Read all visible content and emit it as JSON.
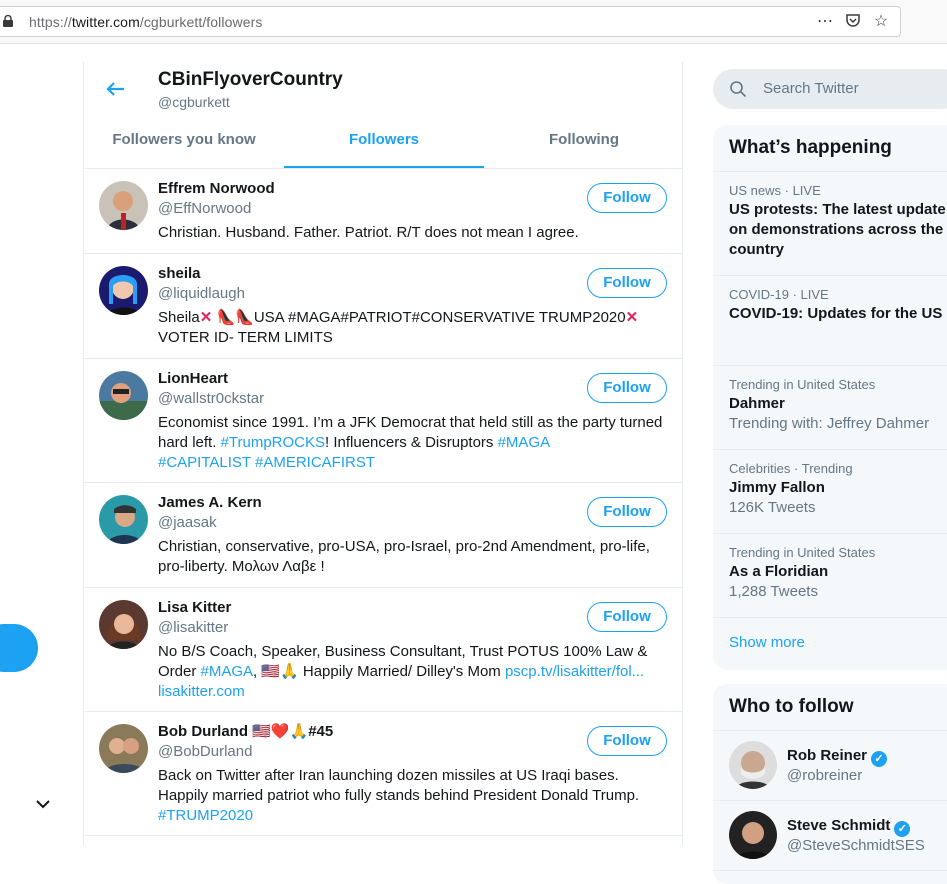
{
  "browser": {
    "url_prefix": "https://",
    "url_host": "twitter.com",
    "url_path": "/cgburkett/followers",
    "more_icon": "⋯",
    "pocket_icon": "pocket-icon",
    "star_icon": "☆"
  },
  "header": {
    "name": "CBinFlyoverCountry",
    "handle": "@cgburkett",
    "tabs": [
      "Followers you know",
      "Followers",
      "Following"
    ]
  },
  "follow_label": "Follow",
  "users": [
    {
      "name": "Effrem Norwood",
      "handle": "@EffNorwood",
      "bio": "Christian. Husband. Father. Patriot. R/T does not mean I agree."
    },
    {
      "name": "sheila",
      "handle": "@liquidlaugh",
      "bio_a": "Sheila",
      "bio_b": "USA #MAGA#PATRIOT#CONSERVATIVE TRUMP2020",
      "bio_c": "VOTER ID- TERM LIMITS"
    },
    {
      "name": "LionHeart",
      "handle": "@wallstr0ckstar",
      "bio_a": "Economist since 1991. I’m a JFK Democrat that held still as the party turned hard left. ",
      "link1": "#TrumpROCKS",
      "bio_b": "! Influencers & Disruptors ",
      "link2": "#MAGA",
      "link3": "#CAPITALIST",
      "link4": "#AMERICAFIRST"
    },
    {
      "name": "James A. Kern",
      "handle": "@jaasak",
      "bio": "Christian, conservative, pro-USA, pro-Israel, pro-2nd Amendment, pro-life, pro-liberty. Μολων Λαβε !"
    },
    {
      "name": "Lisa Kitter",
      "handle": "@lisakitter",
      "bio_a": "No B/S Coach, Speaker, Business Consultant, Trust POTUS 100% Law & Order ",
      "link1": "#MAGA",
      "bio_b": ", 🇺🇸🙏 Happily Married/ Dilley's Mom ",
      "link2": "pscp.tv/lisakitter/fol...",
      "link3": "lisakitter.com"
    },
    {
      "name": "Bob Durland",
      "name_suffix": "🇺🇸❤️🙏#45",
      "handle": "@BobDurland",
      "bio": "Back on Twitter after Iran launching dozen missiles at US Iraqi bases. Happily married patriot who fully stands behind President Donald Trump.",
      "link1": "#TRUMP2020"
    }
  ],
  "search": {
    "placeholder": "Search Twitter"
  },
  "whats_happening": {
    "title": "What’s happening",
    "trends": [
      {
        "meta": "US news · LIVE",
        "title1": "US protests: The latest update",
        "title2": "on demonstrations across the",
        "title3": "country"
      },
      {
        "meta": "COVID-19 · LIVE",
        "title1": "COVID-19: Updates for the US"
      },
      {
        "meta": "Trending in United States",
        "title1": "Dahmer",
        "sub": "Trending with: Jeffrey Dahmer"
      },
      {
        "meta": "Celebrities · Trending",
        "title1": "Jimmy Fallon",
        "sub": "126K Tweets"
      },
      {
        "meta": "Trending in United States",
        "title1": "As a Floridian",
        "sub": "1,288 Tweets"
      }
    ],
    "show_more": "Show more"
  },
  "who_to_follow": {
    "title": "Who to follow",
    "accounts": [
      {
        "name": "Rob Reiner",
        "handle": "@robreiner"
      },
      {
        "name": "Steve Schmidt",
        "handle": "@SteveSchmidtSES"
      }
    ]
  },
  "colors": {
    "accent": "#1da1f2",
    "muted": "#657786",
    "border": "#e6ecf0"
  }
}
